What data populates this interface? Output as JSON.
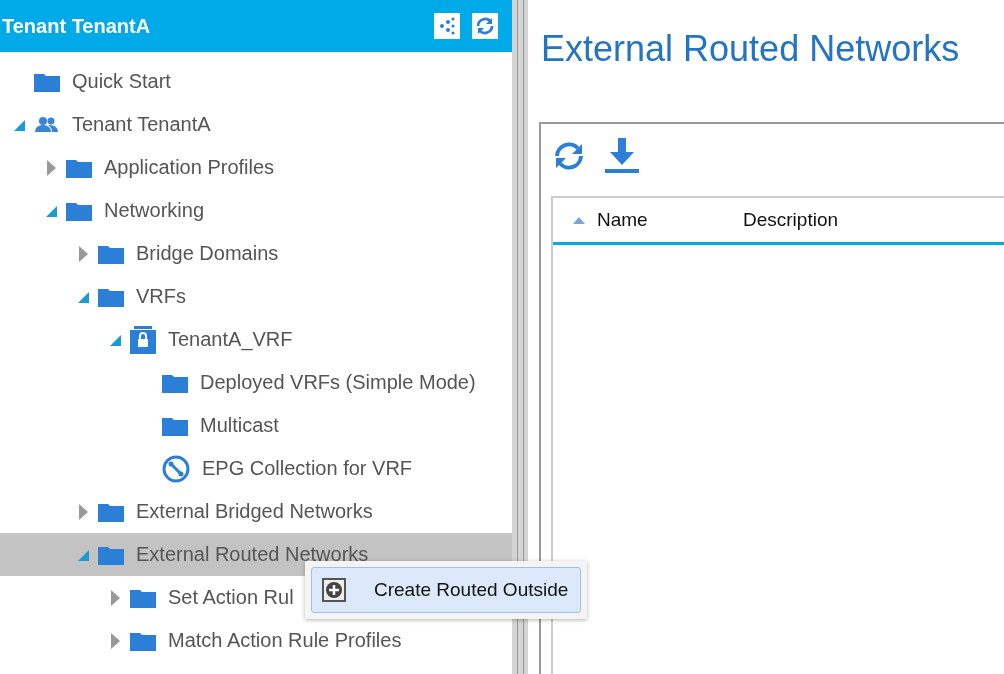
{
  "panel": {
    "title": "Tenant TenantA"
  },
  "tree": [
    {
      "label": "Quick Start",
      "kind": "folder",
      "selected": false
    },
    {
      "label": "Tenant TenantA",
      "kind": "tenant",
      "expanded": true,
      "selected": false,
      "children": [
        {
          "label": "Application Profiles",
          "kind": "folder",
          "expanded": false,
          "selected": false
        },
        {
          "label": "Networking",
          "kind": "folder",
          "expanded": true,
          "selected": false,
          "children": [
            {
              "label": "Bridge Domains",
              "kind": "folder",
              "expanded": false,
              "selected": false
            },
            {
              "label": "VRFs",
              "kind": "folder",
              "expanded": true,
              "selected": false,
              "children": [
                {
                  "label": "TenantA_VRF",
                  "kind": "vrf",
                  "expanded": true,
                  "selected": false,
                  "children": [
                    {
                      "label": "Deployed VRFs (Simple Mode)",
                      "kind": "folder",
                      "selected": false
                    },
                    {
                      "label": "Multicast",
                      "kind": "folder",
                      "selected": false
                    },
                    {
                      "label": "EPG Collection for VRF",
                      "kind": "collection",
                      "selected": false
                    }
                  ]
                }
              ]
            },
            {
              "label": "External Bridged Networks",
              "kind": "folder",
              "expanded": false,
              "selected": false
            },
            {
              "label": "External Routed Networks",
              "kind": "folder",
              "expanded": true,
              "selected": true,
              "children": [
                {
                  "label": "Set Action Rul",
                  "kind": "folder",
                  "expanded": false,
                  "selected": false
                },
                {
                  "label": "Match Action Rule Profiles",
                  "kind": "folder",
                  "expanded": false,
                  "selected": false
                }
              ]
            }
          ]
        }
      ]
    }
  ],
  "page": {
    "title": "External Routed Networks"
  },
  "table": {
    "columns": [
      {
        "label": "Name",
        "sorted": true
      },
      {
        "label": "Description",
        "sorted": false
      }
    ]
  },
  "context_menu": {
    "items": [
      {
        "label": "Create Routed Outside"
      }
    ]
  }
}
